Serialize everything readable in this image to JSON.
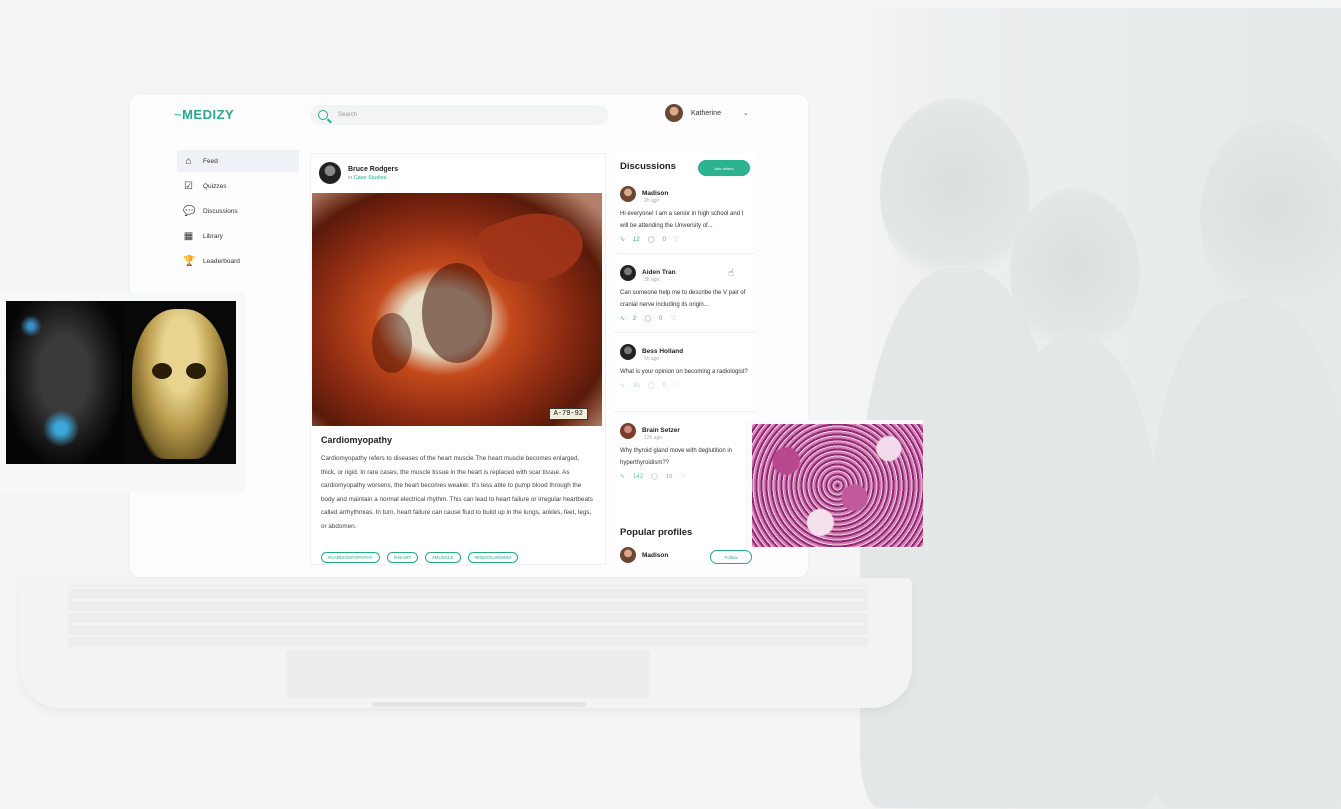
{
  "app": {
    "logo_text": "MEDIZY",
    "accent_color": "#2bb38f",
    "search": {
      "placeholder": "Search"
    },
    "user": {
      "name": "Katherine",
      "caret": "⌄"
    }
  },
  "sidebar": {
    "items": [
      {
        "label": "Feed",
        "icon": "home-icon",
        "active": true
      },
      {
        "label": "Quizzes",
        "icon": "quiz-icon",
        "active": false
      },
      {
        "label": "Discussions",
        "icon": "chat-icon",
        "active": false
      },
      {
        "label": "Library",
        "icon": "library-icon",
        "active": false
      },
      {
        "label": "Leaderboard",
        "icon": "trophy-icon",
        "active": false
      }
    ]
  },
  "post": {
    "author": "Bruce Rodgers",
    "category_prefix": "in",
    "category": "Case Studies",
    "image_label": "A-79-92",
    "title": "Cardiomyopathy",
    "body": "Cardiomyopathy refers to diseases of the heart muscle.The heart muscle becomes enlarged, thick, or rigid. In rare cases, the muscle tissue in the heart is replaced with scar tissue. As cardiomyopathy worsens, the heart becomes weaker. It's less able to pump blood through the body and maintain a normal electrical rhythm. This can lead to heart failure or irregular heartbeats called arrhythmias. In turn, heart failure can cause fluid to build up in the lungs, ankles, feet, legs, or abdomen.",
    "tags": [
      "#CARDIOMYOPATHY",
      "#HEART",
      "#MUSCLE",
      "#ENDOCARDIUM"
    ]
  },
  "discussions": {
    "title": "Discussions",
    "ask_button": "Ask others",
    "items": [
      {
        "name": "Madison",
        "time": "2h ago",
        "text": "Hi everyone! I am a senior in high school and I will be attending the University of...",
        "likes": "12",
        "comments": "0"
      },
      {
        "name": "Aiden Tran",
        "time": "3h ago",
        "text": "Can someone help me to describe the V pair of cranial nerve including its origin...",
        "likes": "2",
        "comments": "0"
      },
      {
        "name": "Bess Holland",
        "time": "5h ago",
        "text": "What is your opinion on becoming a radiologist?",
        "likes": "30",
        "comments": "0"
      },
      {
        "name": "Brain Setzer",
        "time": "12h ago",
        "text": "Why thyroid gland move with deglutition in hyperthyroidism??",
        "likes": "142",
        "comments": "16"
      }
    ]
  },
  "popular": {
    "title": "Popular profiles",
    "first_name": "Madison",
    "follow_label": "Follow"
  }
}
